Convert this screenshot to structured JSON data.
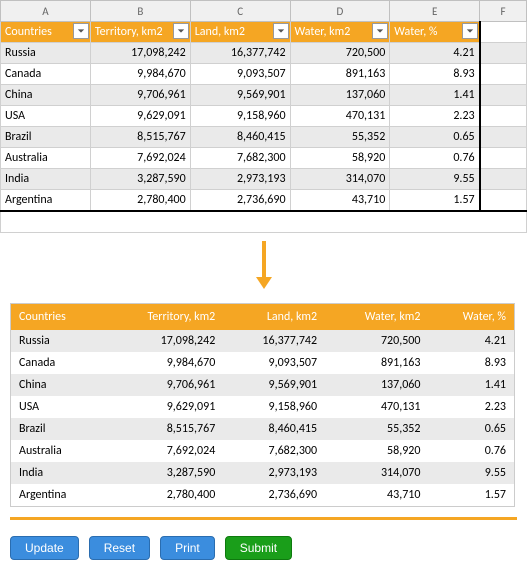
{
  "cols": [
    "A",
    "B",
    "C",
    "D",
    "E",
    "F"
  ],
  "headers": {
    "a": "Countries",
    "b": "Territory, km2",
    "c": "Land, km2",
    "d": "Water, km2",
    "e": "Water, %"
  },
  "rows": [
    {
      "a": "Russia",
      "b": "17,098,242",
      "c": "16,377,742",
      "d": "720,500",
      "e": "4.21"
    },
    {
      "a": "Canada",
      "b": "9,984,670",
      "c": "9,093,507",
      "d": "891,163",
      "e": "8.93"
    },
    {
      "a": "China",
      "b": "9,706,961",
      "c": "9,569,901",
      "d": "137,060",
      "e": "1.41"
    },
    {
      "a": "USA",
      "b": "9,629,091",
      "c": "9,158,960",
      "d": "470,131",
      "e": "2.23"
    },
    {
      "a": "Brazil",
      "b": "8,515,767",
      "c": "8,460,415",
      "d": "55,352",
      "e": "0.65"
    },
    {
      "a": "Australia",
      "b": "7,692,024",
      "c": "7,682,300",
      "d": "58,920",
      "e": "0.76"
    },
    {
      "a": "India",
      "b": "3,287,590",
      "c": "2,973,193",
      "d": "314,070",
      "e": "9.55"
    },
    {
      "a": "Argentina",
      "b": "2,780,400",
      "c": "2,736,690",
      "d": "43,710",
      "e": "1.57"
    }
  ],
  "buttons": {
    "update": "Update",
    "reset": "Reset",
    "print": "Print",
    "submit": "Submit"
  },
  "chart_data": {
    "type": "table",
    "columns": [
      "Countries",
      "Territory, km2",
      "Land, km2",
      "Water, km2",
      "Water, %"
    ],
    "data": [
      [
        "Russia",
        17098242,
        16377742,
        720500,
        4.21
      ],
      [
        "Canada",
        9984670,
        9093507,
        891163,
        8.93
      ],
      [
        "China",
        9706961,
        9569901,
        137060,
        1.41
      ],
      [
        "USA",
        9629091,
        9158960,
        470131,
        2.23
      ],
      [
        "Brazil",
        8515767,
        8460415,
        55352,
        0.65
      ],
      [
        "Australia",
        7692024,
        7682300,
        58920,
        0.76
      ],
      [
        "India",
        3287590,
        2973193,
        314070,
        9.55
      ],
      [
        "Argentina",
        2780400,
        2736690,
        43710,
        1.57
      ]
    ]
  }
}
